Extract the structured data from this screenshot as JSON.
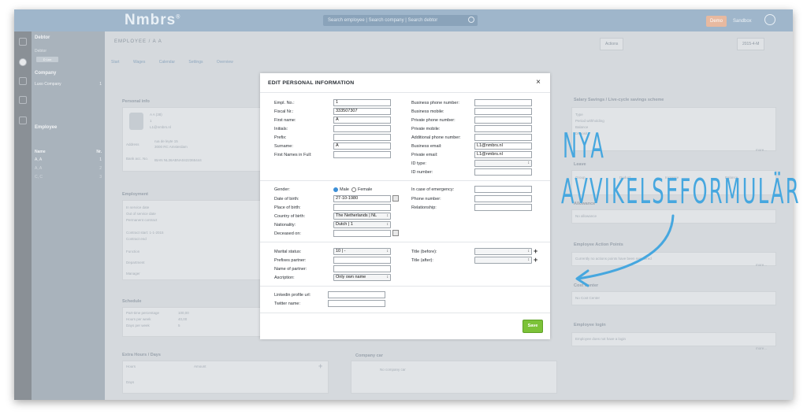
{
  "app": {
    "logo": "Nmbrs",
    "logo_mark": "®",
    "search_placeholder": "Search employee | Search company | Search debtor",
    "demo_label": "Demo",
    "sandbox_label": "Sandbox"
  },
  "sidebar": {
    "debtor_title": "Debtor",
    "debtor_sub": "Debtor",
    "debtor_pill": "D Lux",
    "company_title": "Company",
    "company_item": "Luxo Company",
    "company_count": "1",
    "employee_title": "Employee",
    "col_name": "Name",
    "col_nr": "Nr.",
    "employees": [
      {
        "name": "A, A",
        "nr": "1"
      },
      {
        "name": "A, A",
        "nr": "2"
      },
      {
        "name": "C, C",
        "nr": "3"
      }
    ]
  },
  "main": {
    "breadcrumb": "EMPLOYEE / A A",
    "tabs": [
      "Start",
      "Wages",
      "Calendar",
      "Settings",
      "Overview"
    ],
    "toolbar": {
      "actions": "Actions",
      "period": "2015-4-M"
    },
    "personal_info_title": "Personal info",
    "personal_info_lines": [
      "A A (38)",
      "1",
      "L1@nmbrs.nl"
    ],
    "address_label": "Address",
    "address_lines": [
      "rua de leyte 15",
      "3000 RC Amsterdam"
    ],
    "bank_label": "Bank acc. No.",
    "bank_value": "IBAN NL36ABNA0422365444",
    "employment_title": "Employment",
    "employment_lines": [
      "In service date",
      "Out of service date",
      "Permanent contract",
      "Contract start: 1-1-2015",
      "Contract end",
      "Function",
      "Department",
      "Manager"
    ],
    "schedule_title": "Schedule",
    "schedule_rows": [
      {
        "label": "Part-time percentage",
        "value": "100,00"
      },
      {
        "label": "Hours per week",
        "value": "40,00"
      },
      {
        "label": "Days per week",
        "value": "5"
      }
    ],
    "extra_hours_title": "Extra Hours / Days",
    "extra_cols": [
      "Hours",
      "Amount"
    ],
    "extra_row": "Days",
    "company_car_title": "Company car",
    "company_car_text": "No company car",
    "right_titles": [
      "Salary Savings / Live-cycle savings scheme",
      "Leave",
      "Allowance",
      "Employee Action Points",
      "Cost Center",
      "Employee login"
    ],
    "right_texts": [
      "Type",
      "Period withholding",
      "Balance",
      "Deposit",
      "No allowance",
      "Currently no actions points have been registered",
      "No Cost Center",
      "Employee does not have a login"
    ],
    "leave_cols": [
      "Group",
      "Deduct",
      "Increase",
      "Balance"
    ],
    "more": "more..."
  },
  "modal": {
    "title": "EDIT PERSONAL INFORMATION",
    "close": "×",
    "left_fields": [
      {
        "label": "Empl. No.:",
        "value": "1"
      },
      {
        "label": "Fiscal Nr.:",
        "value": "333507307"
      },
      {
        "label": "First name:",
        "value": "A"
      },
      {
        "label": "Initials:",
        "value": ""
      },
      {
        "label": "Prefix:",
        "value": ""
      },
      {
        "label": "Surname:",
        "value": "A"
      },
      {
        "label": "First Names in Full:",
        "value": ""
      }
    ],
    "right_fields": [
      {
        "label": "Business phone number:",
        "value": ""
      },
      {
        "label": "Business mobile:",
        "value": ""
      },
      {
        "label": "Private phone number:",
        "value": ""
      },
      {
        "label": "Private mobile:",
        "value": ""
      },
      {
        "label": "Additional phone number:",
        "value": ""
      },
      {
        "label": "Business email:",
        "value": "L1@nmbrs.nl"
      },
      {
        "label": "Private email:",
        "value": "L1@nmbrs.nl"
      },
      {
        "label": "ID type:",
        "value": ""
      },
      {
        "label": "ID number:",
        "value": ""
      }
    ],
    "gender_label": "Gender:",
    "gender_male": "Male",
    "gender_female": "Female",
    "dob_label": "Date of birth:",
    "dob_value": "27-10-1980",
    "pob_label": "Place of birth:",
    "pob_value": "",
    "country_label": "Country of birth:",
    "country_value": "The Netherlands | NL",
    "nationality_label": "Nationality:",
    "nationality_value": "Dutch | 1",
    "deceased_label": "Deceased on:",
    "deceased_value": "",
    "emergency_label": "In case of emergency:",
    "phone_label": "Phone number:",
    "relationship_label": "Relationship:",
    "marital_label": "Marital status:",
    "marital_value": "10 | -",
    "prefixes_partner_label": "Prefixes partner:",
    "name_partner_label": "Name of partner:",
    "ascription_label": "Ascription:",
    "ascription_value": "Only own name",
    "title_before_label": "Title (before):",
    "title_after_label": "Title (after):",
    "linkedin_label": "Linkedin profile url:",
    "twitter_label": "Twitter name:",
    "save_label": "Save"
  },
  "annotation": {
    "line1": "NYA",
    "line2": "AVVIKELSEFORMULÄR",
    "color": "#46a7df"
  }
}
